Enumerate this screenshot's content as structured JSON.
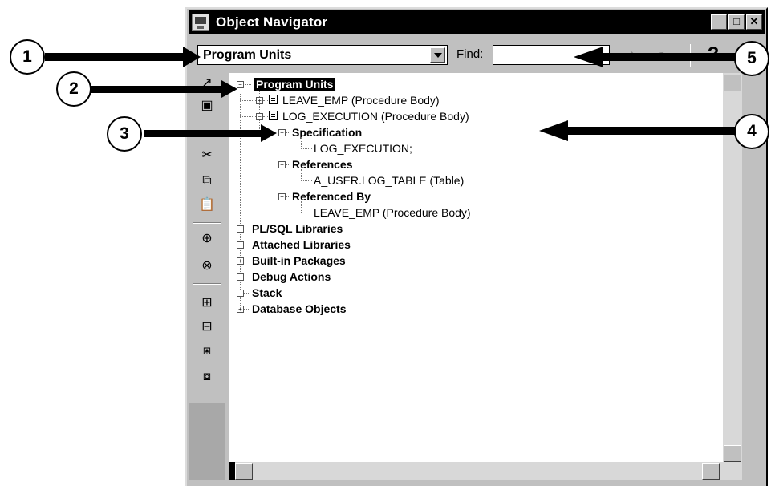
{
  "window": {
    "title": "Object Navigator"
  },
  "toolbar": {
    "combo_value": "Program Units",
    "find_label": "Find:",
    "find_value": "",
    "help_label": "?"
  },
  "tree": {
    "root": "Program Units",
    "leave_emp": "LEAVE_EMP (Procedure Body)",
    "log_execution": "LOG_EXECUTION (Procedure Body)",
    "specification": "Specification",
    "spec_child": "LOG_EXECUTION;",
    "references": "References",
    "ref_child": "A_USER.LOG_TABLE (Table)",
    "referenced_by": "Referenced By",
    "refby_child": "LEAVE_EMP (Procedure Body)",
    "plsql_libraries": "PL/SQL Libraries",
    "attached_libraries": "Attached Libraries",
    "builtin_packages": "Built-in Packages",
    "debug_actions": "Debug Actions",
    "stack": "Stack",
    "database_objects": "Database Objects"
  },
  "callouts": [
    "1",
    "2",
    "3",
    "4",
    "5"
  ]
}
